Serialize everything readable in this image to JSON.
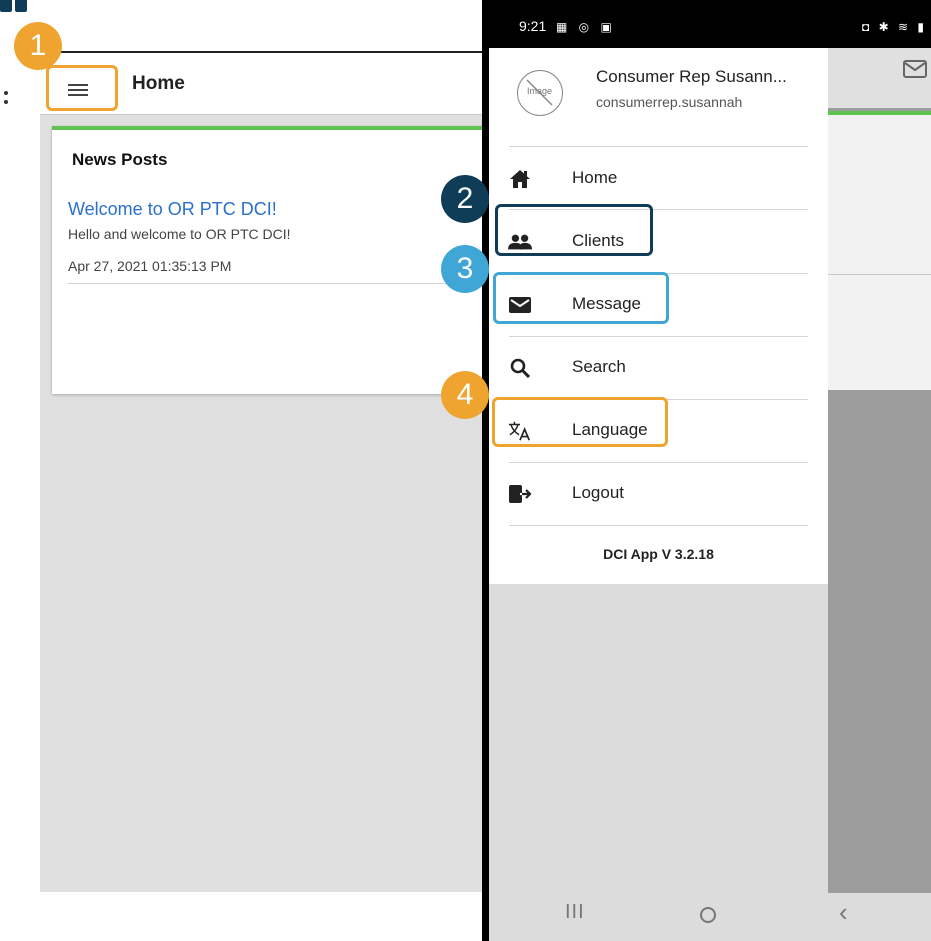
{
  "left_screen": {
    "header": {
      "title": "Home"
    },
    "news_card": {
      "heading": "News Posts",
      "post": {
        "title": "Welcome to OR PTC DCI!",
        "body": "Hello and welcome to OR PTC DCI!",
        "date": "Apr 27, 2021 01:35:13 PM"
      }
    }
  },
  "phone": {
    "status_bar": {
      "time": "9:21",
      "left_icons": "▦ ◎ ▣",
      "right_icons": "◘ ✱ ≋ ▮"
    },
    "drawer": {
      "avatar_placeholder": "Image",
      "user_name": "Consumer Rep Susann...",
      "user_email": "consumerrep.susannah",
      "items": [
        {
          "label": "Home",
          "icon": "home-icon"
        },
        {
          "label": "Clients",
          "icon": "people-icon"
        },
        {
          "label": "Message",
          "icon": "mail-icon"
        },
        {
          "label": "Search",
          "icon": "search-icon"
        },
        {
          "label": "Language",
          "icon": "translate-icon"
        },
        {
          "label": "Logout",
          "icon": "logout-icon"
        }
      ],
      "version": "DCI App V 3.2.18"
    },
    "nav_bar": {
      "recent": "III",
      "back": "‹"
    }
  },
  "callouts": [
    "1",
    "2",
    "3",
    "4"
  ],
  "colors": {
    "orange": "#f0a430",
    "navy": "#0f3d57",
    "blue": "#3fa6d6",
    "accent_green": "#5dc54f",
    "link_blue": "#2b6fcf"
  }
}
